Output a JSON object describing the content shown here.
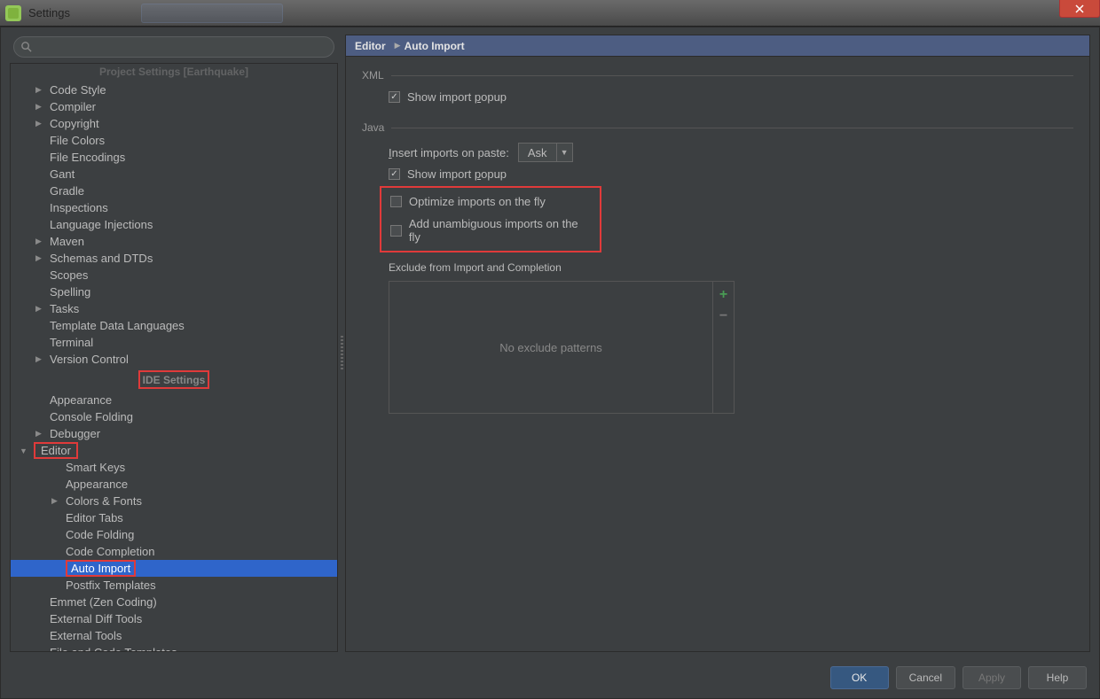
{
  "window": {
    "title": "Settings"
  },
  "breadcrumb": {
    "root": "Editor",
    "leaf": "Auto Import"
  },
  "sections": {
    "project": "Project Settings [Earthquake]",
    "ide": "IDE Settings"
  },
  "tree": {
    "project_items": [
      {
        "label": "Code Style",
        "arrow": "▶"
      },
      {
        "label": "Compiler",
        "arrow": "▶"
      },
      {
        "label": "Copyright",
        "arrow": "▶"
      },
      {
        "label": "File Colors"
      },
      {
        "label": "File Encodings"
      },
      {
        "label": "Gant"
      },
      {
        "label": "Gradle"
      },
      {
        "label": "Inspections"
      },
      {
        "label": "Language Injections"
      },
      {
        "label": "Maven",
        "arrow": "▶"
      },
      {
        "label": "Schemas and DTDs",
        "arrow": "▶"
      },
      {
        "label": "Scopes"
      },
      {
        "label": "Spelling"
      },
      {
        "label": "Tasks",
        "arrow": "▶"
      },
      {
        "label": "Template Data Languages"
      },
      {
        "label": "Terminal"
      },
      {
        "label": "Version Control",
        "arrow": "▶"
      }
    ],
    "ide_items_top": [
      {
        "label": "Appearance"
      },
      {
        "label": "Console Folding"
      },
      {
        "label": "Debugger",
        "arrow": "▶"
      }
    ],
    "editor": {
      "label": "Editor",
      "arrow": "▼"
    },
    "editor_children": [
      {
        "label": "Smart Keys"
      },
      {
        "label": "Appearance"
      },
      {
        "label": "Colors & Fonts",
        "arrow": "▶"
      },
      {
        "label": "Editor Tabs"
      },
      {
        "label": "Code Folding"
      },
      {
        "label": "Code Completion"
      },
      {
        "label": "Auto Import",
        "selected": true
      },
      {
        "label": "Postfix Templates"
      }
    ],
    "ide_items_bottom": [
      {
        "label": "Emmet (Zen Coding)"
      },
      {
        "label": "External Diff Tools"
      },
      {
        "label": "External Tools"
      },
      {
        "label": "File and Code Templates"
      }
    ]
  },
  "panel": {
    "xml": {
      "label": "XML",
      "show_popup": "Show import popup",
      "show_popup_u": "p"
    },
    "java": {
      "label": "Java",
      "insert_label": "Insert imports on paste:",
      "insert_u": "I",
      "insert_value": "Ask",
      "show_popup": "Show import popup",
      "show_popup_u": "p",
      "optimize": "Optimize imports on the fly",
      "unambiguous": "Add unambiguous imports on the fly",
      "exclude_label": "Exclude from Import and Completion",
      "exclude_empty": "No exclude patterns"
    }
  },
  "buttons": {
    "ok": "OK",
    "cancel": "Cancel",
    "apply": "Apply",
    "help": "Help"
  }
}
